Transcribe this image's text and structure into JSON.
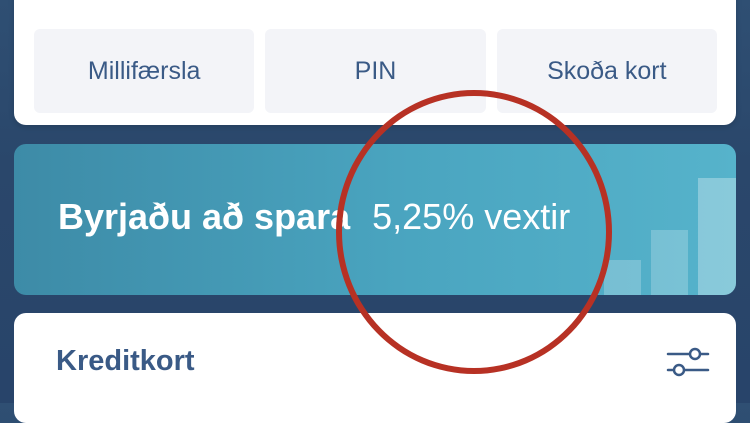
{
  "actions": {
    "transfer_label": "Millifærsla",
    "pin_label": "PIN",
    "view_card_label": "Skoða kort"
  },
  "banner": {
    "title": "Byrjaðu að spara",
    "rate": "5,25% vextir"
  },
  "credit_panel": {
    "title": "Kreditkort",
    "filter_icon": "sliders-icon"
  },
  "colors": {
    "accent_text": "#3a5a86",
    "banner_start": "#3d8ba7",
    "banner_end": "#56b3cb",
    "annotation_circle": "#b73124"
  }
}
